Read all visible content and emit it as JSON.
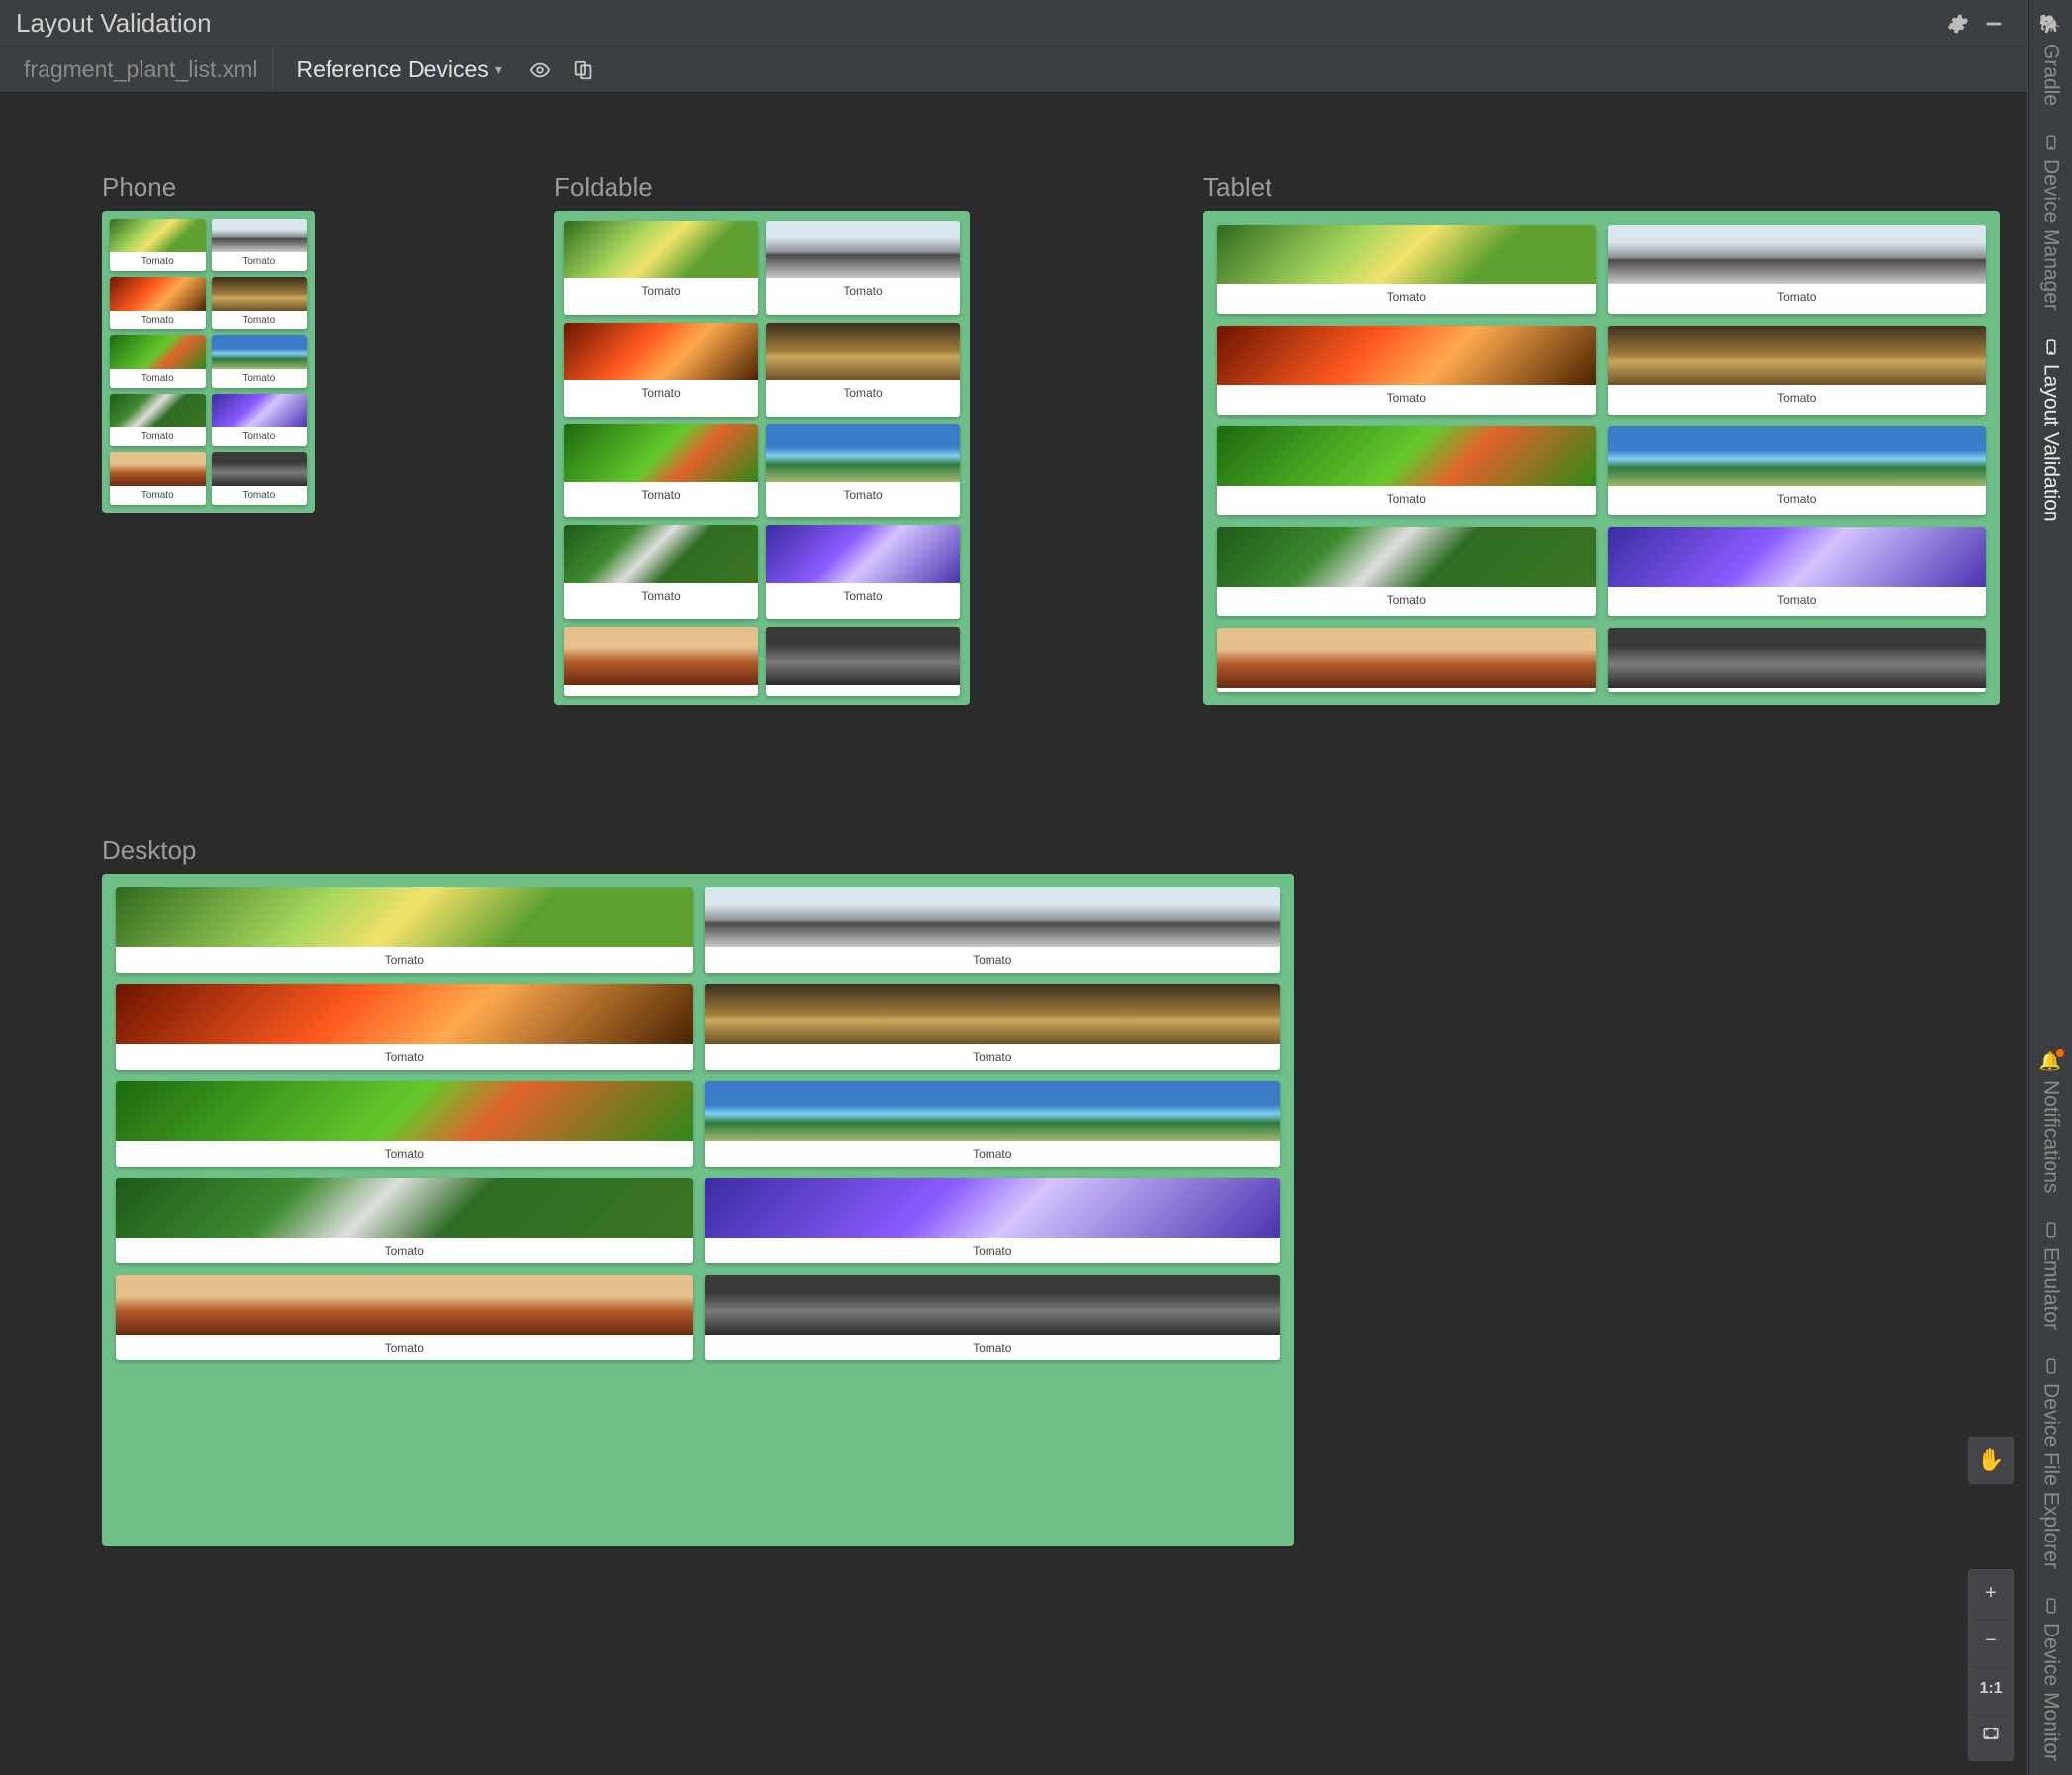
{
  "header": {
    "title": "Layout Validation"
  },
  "subheader": {
    "file_tab": "fragment_plant_list.xml",
    "dropdown_label": "Reference Devices"
  },
  "devices": {
    "phone": {
      "label": "Phone"
    },
    "foldable": {
      "label": "Foldable"
    },
    "tablet": {
      "label": "Tablet"
    },
    "desktop": {
      "label": "Desktop"
    }
  },
  "card_label": "Tomato",
  "zoom": {
    "pan": "✋",
    "plus": "+",
    "minus": "−",
    "one_to_one": "1:1",
    "fit": "⛶"
  },
  "right_rail": {
    "gradle": "Gradle",
    "device_manager": "Device Manager",
    "layout_validation": "Layout Validation",
    "notifications": "Notifications",
    "emulator": "Emulator",
    "device_file_explorer": "Device File Explorer",
    "device_monitor": "Device Monitor"
  },
  "icons": {
    "gear": "gear-icon",
    "minimize": "minimize-icon",
    "eye": "eye-icon",
    "multi": "multi-preview-icon",
    "chevron": "chevron-down-icon"
  },
  "images": [
    "caterpillar",
    "telescope",
    "leaves-red",
    "branch-dew",
    "leaf-green",
    "coast",
    "farm",
    "fungus",
    "desert",
    "forest-bw"
  ]
}
